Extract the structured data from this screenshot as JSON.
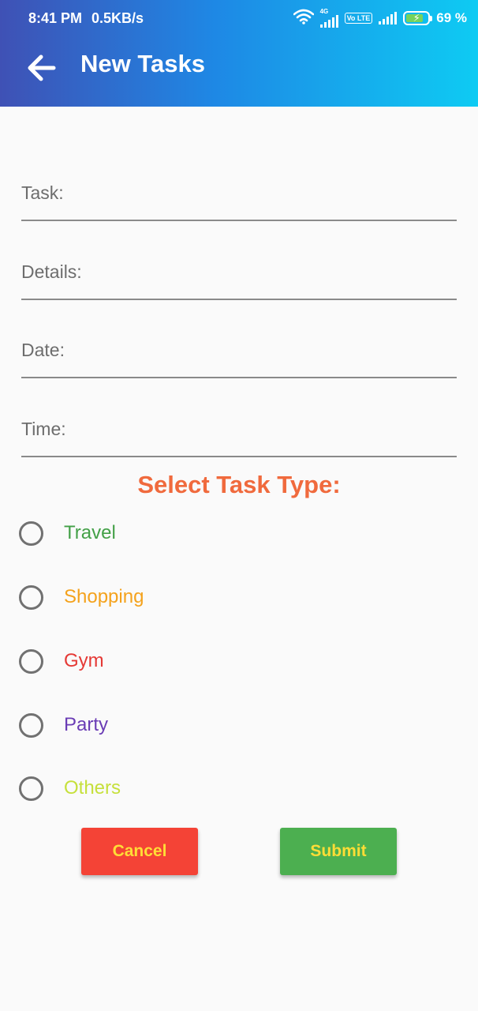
{
  "status_bar": {
    "time": "8:41 PM",
    "speed": "0.5KB/s",
    "network_tag": "4G",
    "volte_tag": "Vo LTE",
    "battery_percent": "69 %",
    "battery_level": 0.69,
    "icons": [
      "wifi-icon",
      "signal-icon",
      "volte-icon",
      "battery-charging-icon"
    ]
  },
  "app_bar": {
    "title": "New Tasks",
    "back_icon": "arrow-left-icon"
  },
  "form": {
    "fields": [
      {
        "placeholder": "Task:",
        "value": ""
      },
      {
        "placeholder": "Details:",
        "value": ""
      },
      {
        "placeholder": "Date:",
        "value": ""
      },
      {
        "placeholder": "Time:",
        "value": ""
      }
    ],
    "task_type_title": "Select Task Type:",
    "task_types": [
      {
        "label": "Travel",
        "color": "#43a047",
        "selected": false
      },
      {
        "label": "Shopping",
        "color": "#f4a21c",
        "selected": false
      },
      {
        "label": "Gym",
        "color": "#e53935",
        "selected": false
      },
      {
        "label": "Party",
        "color": "#6a3cb5",
        "selected": false
      },
      {
        "label": "Others",
        "color": "#c6e03b",
        "selected": false
      }
    ],
    "title_color": "#f06a3d"
  },
  "buttons": {
    "cancel_label": "Cancel",
    "submit_label": "Submit",
    "cancel_color": "#f44336",
    "submit_color": "#4caf50",
    "text_color": "#ffdd36"
  }
}
